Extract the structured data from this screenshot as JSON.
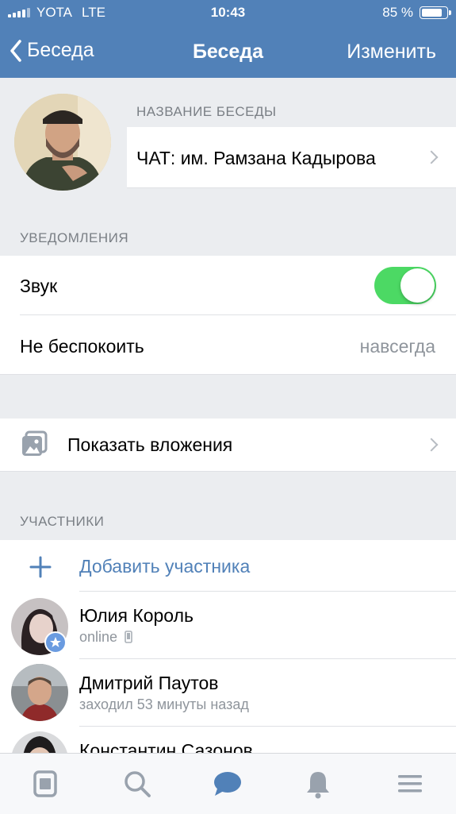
{
  "status_bar": {
    "carrier": "YOTA",
    "network": "LTE",
    "time": "10:43",
    "battery_percent": "85 %",
    "battery_level": 0.85
  },
  "nav": {
    "back_label": "Беседа",
    "title": "Беседа",
    "edit_label": "Изменить"
  },
  "chat": {
    "name_label": "НАЗВАНИЕ БЕСЕДЫ",
    "name_value": "ЧАТ: им. Рамзана Кадырова"
  },
  "notifications": {
    "section_label": "УВЕДОМЛЕНИЯ",
    "sound_label": "Звук",
    "sound_enabled": true,
    "dnd_label": "Не беспокоить",
    "dnd_value": "навсегда"
  },
  "attachments": {
    "label": "Показать вложения"
  },
  "members": {
    "section_label": "УЧАСТНИКИ",
    "add_label": "Добавить участника",
    "items": [
      {
        "name": "Юлия Король",
        "status": "online"
      },
      {
        "name": "Дмитрий Паутов",
        "status": "заходил 53 минуты назад"
      },
      {
        "name": "Константин Сазонов",
        "status": ""
      }
    ]
  },
  "tabbar": {
    "icons": [
      "news-icon",
      "search-icon",
      "messages-icon",
      "notifications-icon",
      "menu-icon"
    ],
    "active_color": "#5181b8",
    "inactive_color": "#99a2ad"
  },
  "colors": {
    "accent": "#5181b8",
    "toggle_on": "#4cd964",
    "background": "#ebedf0"
  }
}
